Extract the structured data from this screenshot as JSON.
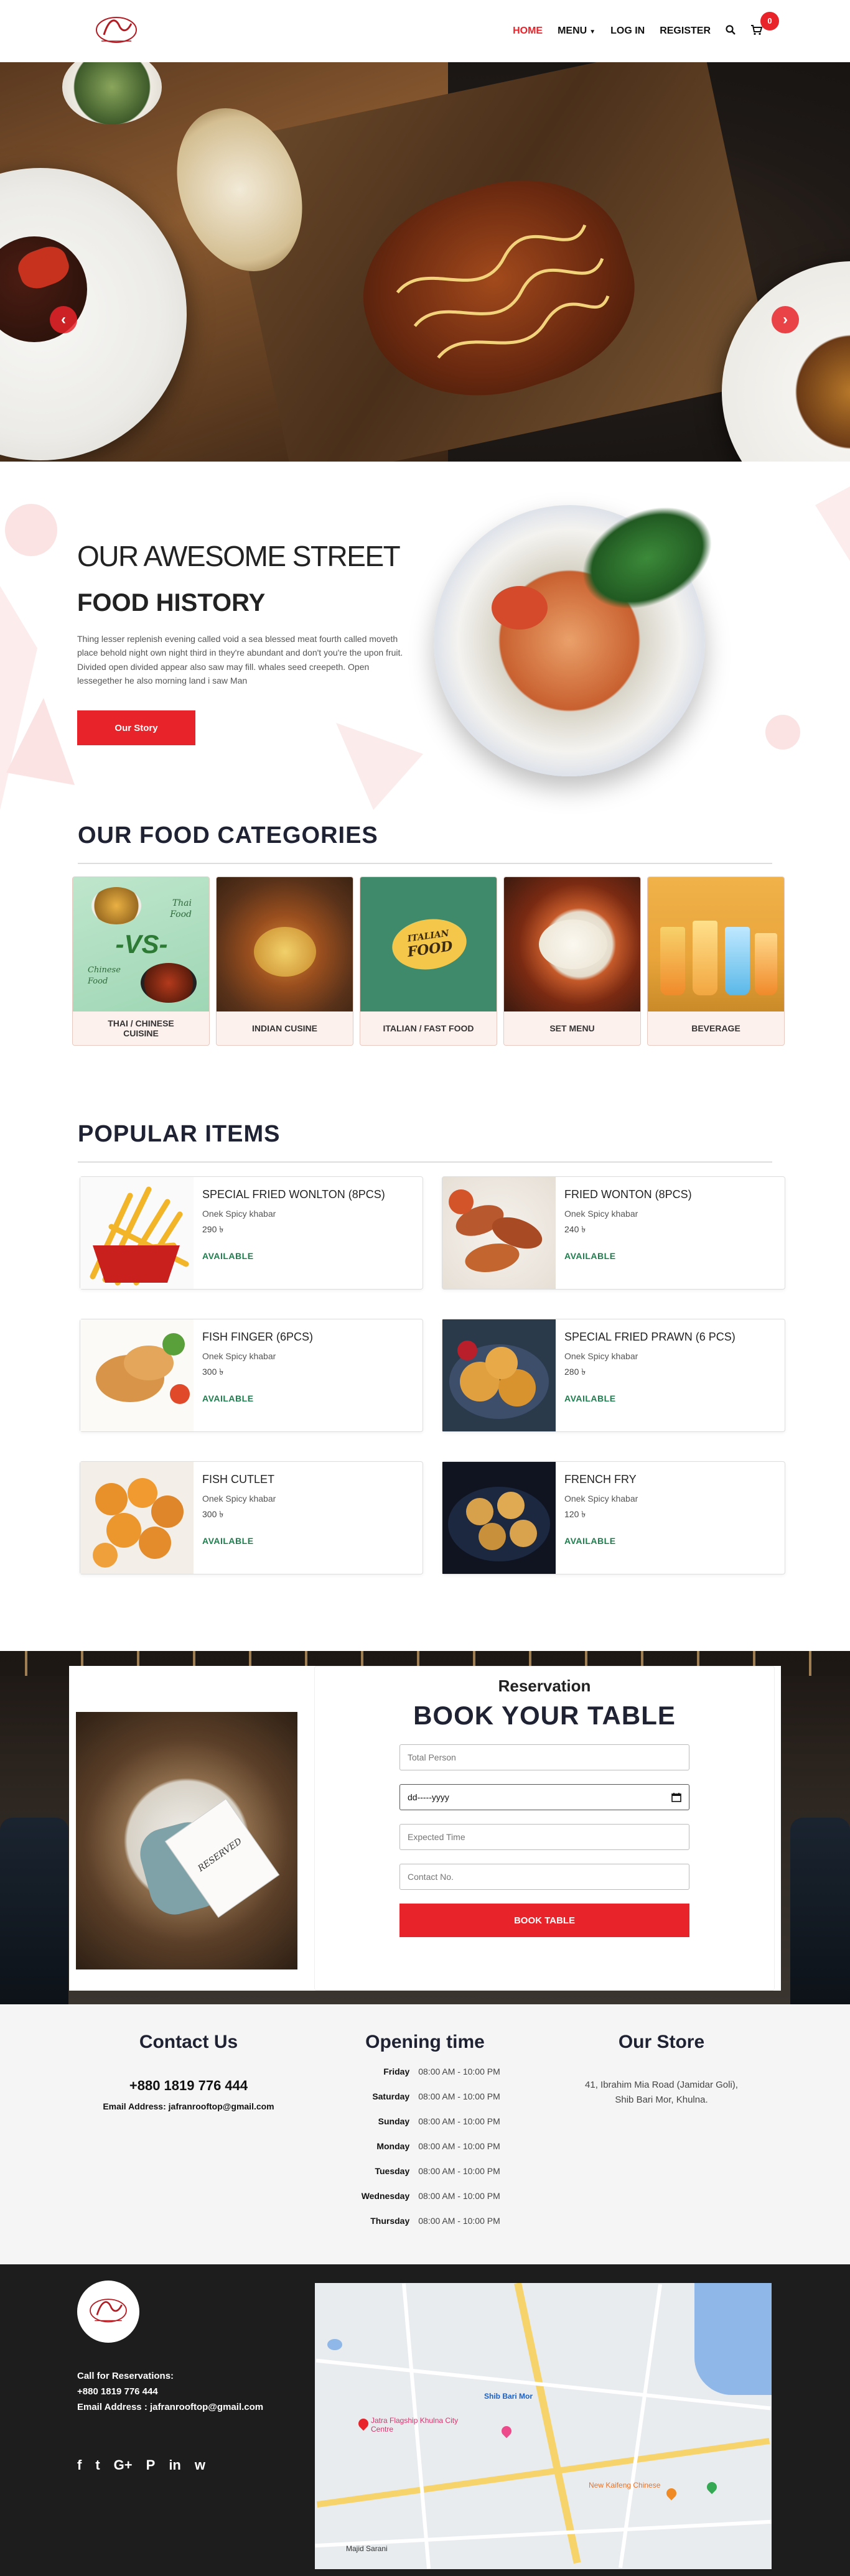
{
  "header": {
    "nav": [
      {
        "label": "HOME",
        "active": true
      },
      {
        "label": "MENU",
        "dropdown": true
      },
      {
        "label": "LOG IN"
      },
      {
        "label": "REGISTER"
      }
    ],
    "cart_count": "0",
    "search_icon": "search-icon",
    "cart_icon": "cart-icon"
  },
  "hero": {
    "prev_icon": "chevron-left-icon",
    "next_icon": "chevron-right-icon"
  },
  "about": {
    "title1": "OUR AWESOME STREET",
    "title2": "FOOD HISTORY",
    "body": "Thing lesser replenish evening called void a sea blessed meat fourth called moveth place behold night own night third in they're abundant and don't you're the upon fruit. Divided open divided appear also saw may fill. whales seed creepeth. Open lessegether he also morning land i saw Man",
    "button": "Our Story"
  },
  "categories": {
    "title": "OUR FOOD CATEGORIES",
    "items": [
      {
        "label": "THAI / CHINESE CUISINE",
        "img_text": [
          "Thai",
          "Food",
          "-VS-",
          "Chinese",
          "Food"
        ]
      },
      {
        "label": "INDIAN CUSINE"
      },
      {
        "label": "ITALIAN / FAST FOOD",
        "img_text": [
          "ITALIAN",
          "FOOD"
        ]
      },
      {
        "label": "SET MENU"
      },
      {
        "label": "BEVERAGE"
      }
    ]
  },
  "popular": {
    "title": "POPULAR ITEMS",
    "items": [
      {
        "name": "SPECIAL FRIED WONLTON (8PCS)",
        "sub": "Onek Spicy khabar",
        "price": "290 ৳",
        "status": "AVAILABLE"
      },
      {
        "name": "FRIED WONTON (8PCS)",
        "sub": "Onek Spicy khabar",
        "price": "240 ৳",
        "status": "AVAILABLE"
      },
      {
        "name": "FISH FINGER (6PCS)",
        "sub": "Onek Spicy khabar",
        "price": "300 ৳",
        "status": "AVAILABLE"
      },
      {
        "name": "SPECIAL FRIED PRAWN (6 PCS)",
        "sub": "Onek Spicy khabar",
        "price": "280 ৳",
        "status": "AVAILABLE"
      },
      {
        "name": "FISH CUTLET",
        "sub": "Onek Spicy khabar",
        "price": "300 ৳",
        "status": "AVAILABLE"
      },
      {
        "name": "FRENCH FRY",
        "sub": "Onek Spicy khabar",
        "price": "120 ৳",
        "status": "AVAILABLE"
      }
    ]
  },
  "reservation": {
    "subtitle": "Reservation",
    "title": "BOOK YOUR TABLE",
    "card_text": "RESERVED",
    "fields": {
      "total_person": "Total Person",
      "date": "dd-----yyyy",
      "time": "Expected Time",
      "contact": "Contact No."
    },
    "button": "BOOK TABLE"
  },
  "info": {
    "contact": {
      "title": "Contact Us",
      "phone": "+880 1819 776 444",
      "email": "Email Address: jafranrooftop@gmail.com"
    },
    "hours": {
      "title": "Opening time",
      "rows": [
        {
          "day": "Friday",
          "time": "08:00 AM - 10:00 PM"
        },
        {
          "day": "Saturday",
          "time": "08:00 AM - 10:00 PM"
        },
        {
          "day": "Sunday",
          "time": "08:00 AM - 10:00 PM"
        },
        {
          "day": "Monday",
          "time": "08:00 AM - 10:00 PM"
        },
        {
          "day": "Tuesday",
          "time": "08:00 AM - 10:00 PM"
        },
        {
          "day": "Wednesday",
          "time": "08:00 AM - 10:00 PM"
        },
        {
          "day": "Thursday",
          "time": "08:00 AM - 10:00 PM"
        }
      ]
    },
    "store": {
      "title": "Our Store",
      "address_line1": "41, Ibrahim Mia Road (Jamidar Goli),",
      "address_line2": "Shib Bari Mor, Khulna."
    }
  },
  "footer": {
    "call_label": "Call for Reservations:",
    "phone": "+880 1819 776 444",
    "email": "Email Address : jafranrooftop@gmail.com",
    "social": [
      {
        "icon": "facebook-icon",
        "glyph": "f"
      },
      {
        "icon": "twitter-icon",
        "glyph": "t"
      },
      {
        "icon": "google-plus-icon",
        "glyph": "G+"
      },
      {
        "icon": "pinterest-icon",
        "glyph": "P"
      },
      {
        "icon": "linkedin-icon",
        "glyph": "in"
      },
      {
        "icon": "whatsapp-icon",
        "glyph": "w"
      }
    ],
    "map_labels": [
      "Shib Bari Mor",
      "Jatra Flagship Khulna City Centre",
      "New Kaifeng Chinese",
      "Majid Sarani"
    ]
  },
  "colors": {
    "brand_red": "#e8232a",
    "dark_navy": "#1f2233",
    "available_green": "#1d7d4c",
    "footer_bg": "#1d1d1d"
  }
}
